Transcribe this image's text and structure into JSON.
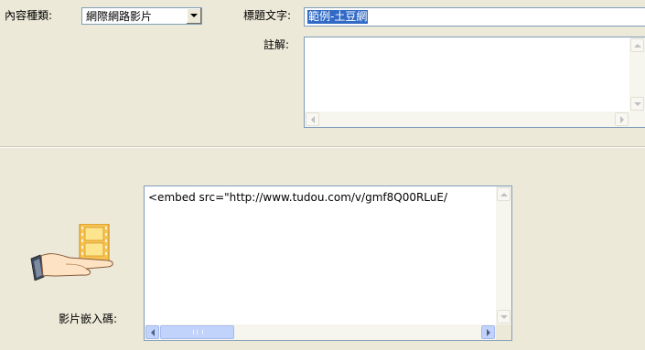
{
  "form": {
    "content_type_label": "內容種類:",
    "content_type_value": "網際網路影片",
    "title_label": "標題文字:",
    "title_value": "範例-土豆網",
    "note_label": "註解:",
    "note_value": "",
    "embed_label": "影片嵌入碼:",
    "embed_value": "<embed src=\"http://www.tudou.com/v/gmf8Q00RLuE/"
  },
  "icons": {
    "dropdown": "chevron-down-icon",
    "media": "hand-holding-film-icon"
  },
  "colors": {
    "background": "#ece9d8",
    "field_border": "#7f9db9",
    "selection": "#316ac5"
  }
}
